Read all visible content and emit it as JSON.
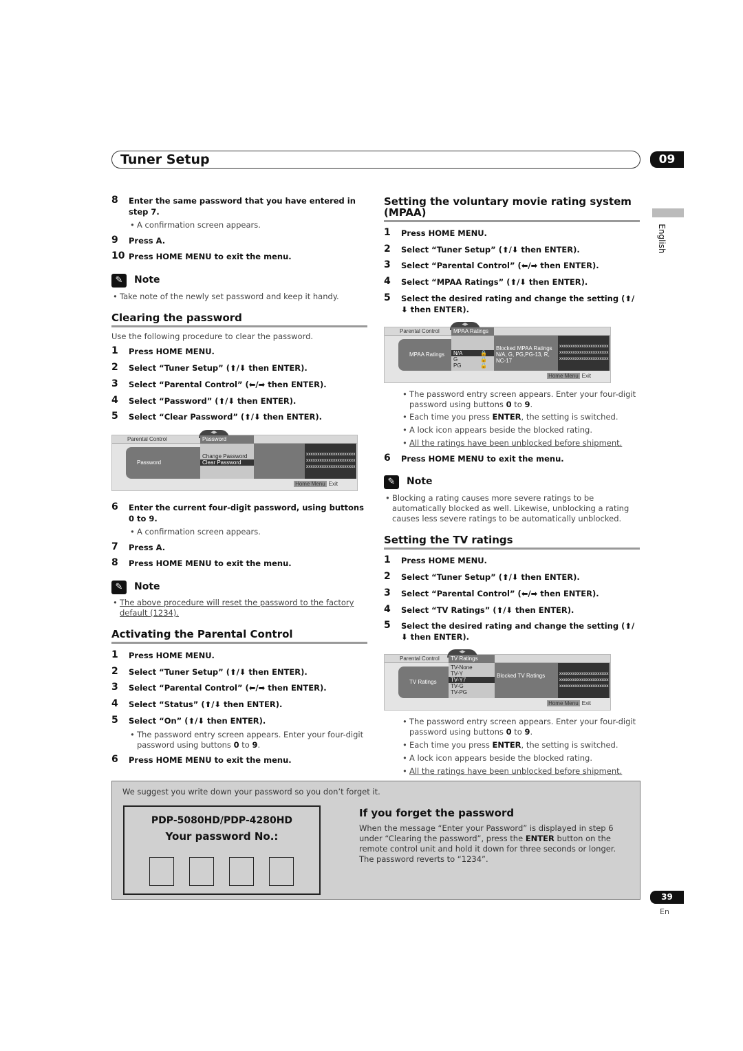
{
  "header": {
    "title": "Tuner Setup",
    "chapter": "09"
  },
  "side": {
    "language": "English"
  },
  "footer": {
    "page": "39",
    "lang": "En"
  },
  "left": {
    "s8": {
      "n": "8",
      "t": "Enter the same password that you have entered in step 7."
    },
    "b1": "A confirmation screen appears.",
    "s9": {
      "n": "9",
      "t": "Press A."
    },
    "s10": {
      "n": "10",
      "t": "Press HOME MENU to exit the menu."
    },
    "note1": {
      "label": "Note",
      "bullet": "Take note of the newly set password and keep it handy."
    },
    "clear": {
      "heading": "Clearing the password",
      "intro": "Use the following procedure to clear the password.",
      "steps": [
        {
          "n": "1",
          "t": "Press HOME MENU."
        },
        {
          "n": "2",
          "t": "Select “Tuner Setup” (⬆/⬇ then ENTER)."
        },
        {
          "n": "3",
          "t": "Select “Parental Control” (⬅/➡ then ENTER)."
        },
        {
          "n": "4",
          "t": "Select “Password” (⬆/⬇ then ENTER)."
        },
        {
          "n": "5",
          "t": "Select “Clear Password” (⬆/⬇ then ENTER)."
        }
      ],
      "screen": {
        "parental": "Parental Control",
        "tab": "Password",
        "left": "Password",
        "items": [
          "Change Password",
          "Clear Password"
        ],
        "selected": 1,
        "x": [
          "xxxxxxxxxxxxxxxxxxxxxx",
          "xxxxxxxxxxxxxxxxxxxxxx",
          "xxxxxxxxxxxxxxxxxxxxxx"
        ],
        "home": "Home Menu",
        "exit": "Exit"
      },
      "s6": {
        "n": "6",
        "t": "Enter the current four-digit password, using buttons 0 to 9."
      },
      "b6": "A confirmation screen appears.",
      "s7": {
        "n": "7",
        "t": "Press A."
      },
      "s8": {
        "n": "8",
        "t": "Press HOME MENU to exit the menu."
      },
      "note": {
        "label": "Note",
        "bullet": "The above procedure will reset the password to the factory default (1234)."
      }
    },
    "activate": {
      "heading": "Activating the Parental Control",
      "steps": [
        {
          "n": "1",
          "t": "Press HOME MENU."
        },
        {
          "n": "2",
          "t": "Select “Tuner Setup” (⬆/⬇ then ENTER)."
        },
        {
          "n": "3",
          "t": "Select “Parental Control” (⬅/➡ then ENTER)."
        },
        {
          "n": "4",
          "t": "Select “Status” (⬆/⬇ then ENTER)."
        },
        {
          "n": "5",
          "t": "Select “On” (⬆/⬇ then ENTER)."
        }
      ],
      "b5": [
        "The password entry screen appears. Enter your four-digit password using buttons ",
        "0",
        " to ",
        "9",
        "."
      ],
      "s6": {
        "n": "6",
        "t": "Press HOME MENU to exit the menu."
      }
    }
  },
  "right": {
    "mpaa": {
      "heading": "Setting the voluntary movie rating system (MPAA)",
      "steps": [
        {
          "n": "1",
          "t": "Press HOME MENU."
        },
        {
          "n": "2",
          "t": "Select “Tuner Setup” (⬆/⬇ then ENTER)."
        },
        {
          "n": "3",
          "t": "Select “Parental Control” (⬅/➡ then ENTER)."
        },
        {
          "n": "4",
          "t": "Select “MPAA Ratings” (⬆/⬇ then ENTER)."
        },
        {
          "n": "5",
          "t": "Select the desired rating and change the setting (⬆/⬇ then ENTER)."
        }
      ],
      "screen": {
        "parental": "Parental Control",
        "tab": "MPAA Ratings",
        "left": "MPAA Ratings",
        "items": [
          "N/A",
          "G",
          "PG"
        ],
        "selected": 0,
        "blocked": "Blocked MPAA Ratings",
        "blocked_list": "N/A, G, PG,PG-13, R, NC-17",
        "x": [
          "xxxxxxxxxxxxxxxxxxxxxx",
          "xxxxxxxxxxxxxxxxxxxxxx",
          "xxxxxxxxxxxxxxxxxxxxxx"
        ],
        "home": "Home Menu",
        "exit": "Exit"
      },
      "bullets": [
        [
          "The password entry screen appears. Enter your four-digit password using buttons ",
          "0",
          " to ",
          "9",
          "."
        ],
        [
          "Each time you press ",
          "ENTER",
          ", the setting is switched."
        ],
        [
          "A lock icon appears beside the blocked rating."
        ],
        [
          "All the ratings have been unblocked before shipment."
        ]
      ],
      "s6": {
        "n": "6",
        "t": "Press HOME MENU to exit the menu."
      },
      "note": {
        "label": "Note",
        "bullet": "Blocking a rating causes more severe ratings to be automatically blocked as well. Likewise, unblocking a rating causes less severe ratings to be automatically unblocked."
      }
    },
    "tv": {
      "heading": "Setting the TV ratings",
      "steps": [
        {
          "n": "1",
          "t": "Press HOME MENU."
        },
        {
          "n": "2",
          "t": "Select “Tuner Setup” (⬆/⬇ then ENTER)."
        },
        {
          "n": "3",
          "t": "Select “Parental Control” (⬅/➡ then ENTER)."
        },
        {
          "n": "4",
          "t": "Select “TV Ratings” (⬆/⬇ then ENTER)."
        },
        {
          "n": "5",
          "t": "Select the desired rating and change the setting (⬆/⬇ then ENTER)."
        }
      ],
      "screen": {
        "parental": "Parental Control",
        "tab": "TV Ratings",
        "left": "TV Ratings",
        "items": [
          "TV-None",
          "TV-Y",
          "TV-Y7",
          "TV-G",
          "TV-PG"
        ],
        "selected": 2,
        "blocked": "Blocked TV Ratings",
        "x": [
          "xxxxxxxxxxxxxxxxxxxxxx",
          "xxxxxxxxxxxxxxxxxxxxxx",
          "xxxxxxxxxxxxxxxxxxxxxx"
        ],
        "home": "Home Menu",
        "exit": "Exit"
      },
      "bullets": [
        [
          "The password entry screen appears. Enter your four-digit password using buttons ",
          "0",
          " to ",
          "9",
          "."
        ],
        [
          "Each time you press ",
          "ENTER",
          ", the setting is switched."
        ],
        [
          "A lock icon appears beside the blocked rating."
        ],
        [
          "All the ratings have been unblocked before shipment."
        ]
      ]
    }
  },
  "memo": {
    "suggest": "We suggest you write down your password so you don’t forget it.",
    "model": "PDP-5080HD/PDP-4280HD",
    "label": "Your password No.:",
    "forget_heading": "If you forget the password",
    "forget_text": [
      "When the message “Enter your Password” is displayed in step 6 under “Clearing the password”, press the ",
      "ENTER",
      " button on the remote control unit and hold it down for three seconds or longer. The password reverts to “1234”."
    ]
  }
}
